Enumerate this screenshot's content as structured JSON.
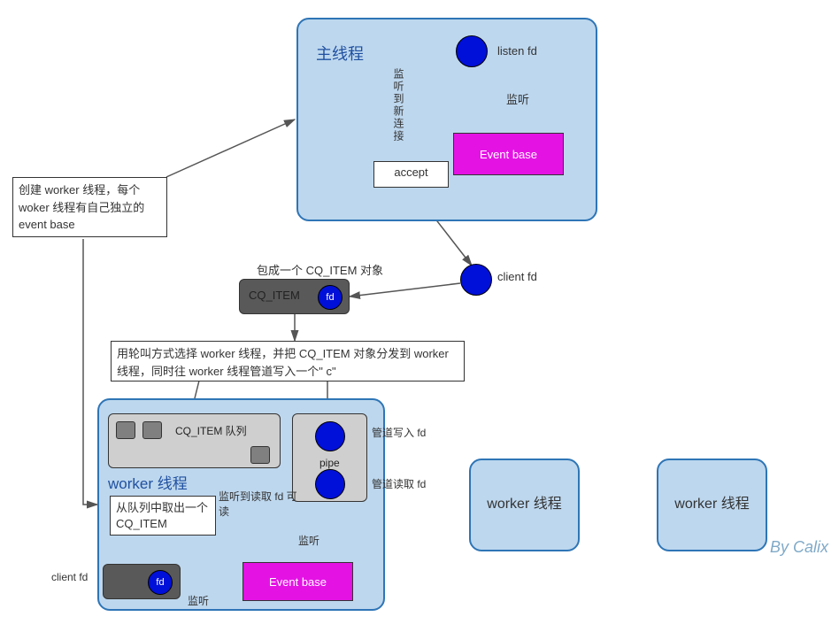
{
  "watermark": "By Calix",
  "main_thread": {
    "title": "主线程",
    "listen_fd": "listen fd",
    "listen_label": "监听",
    "event_base": "Event base",
    "accept": "accept",
    "new_conn_label": "监听到新连接"
  },
  "create_workers_note": "创建 worker 线程，每个 woker 线程有自己独立的 event base",
  "client_fd_label": "client fd",
  "wrap_cq_item": "包成一个 CQ_ITEM 对象",
  "cq_item": {
    "label": "CQ_ITEM",
    "fd": "fd"
  },
  "dispatch_note": "用轮叫方式选择 worker 线程，并把 CQ_ITEM 对象分发到 worker 线程，同时往 worker 线程管道写入一个\" c\"",
  "worker_thread": {
    "title": "worker 线程",
    "queue_label": "CQ_ITEM 队列",
    "pipe": "pipe",
    "pipe_write_fd": "管道写入 fd",
    "pipe_read_fd": "管道读取 fd",
    "listen_read_fd": "监听到读取 fd 可读",
    "take_item": "从队列中取出一个 CQ_ITEM",
    "listen_label": "监听",
    "event_base": "Event base",
    "client_fd_label": "client fd",
    "fd": "fd"
  },
  "worker_box_label": "worker 线程"
}
